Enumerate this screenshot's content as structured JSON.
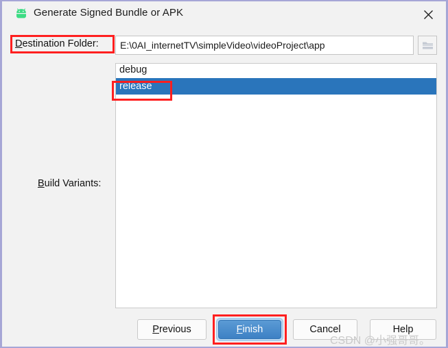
{
  "dialog": {
    "title": "Generate Signed Bundle or APK",
    "app_icon": "android-icon",
    "close_icon": "close-icon",
    "background_color": "#f2f2f2",
    "border_color": "#a6a6d6"
  },
  "destination": {
    "label_prefix": "D",
    "label_rest": "estination Folder:",
    "path_value": "E:\\0AI_internetTV\\simpleVideo\\videoProject\\app",
    "browse_icon": "folder-icon",
    "highlight_color": "#ff1f1f"
  },
  "build_variants": {
    "label_prefix": "B",
    "label_rest": "uild Variants:",
    "items": [
      {
        "label": "debug",
        "selected": false
      },
      {
        "label": "release",
        "selected": true
      }
    ],
    "selection_color": "#2a75bb",
    "highlight_color": "#ff1f1f"
  },
  "buttons": {
    "previous": {
      "prefix": "P",
      "rest": "revious"
    },
    "finish": {
      "prefix": "F",
      "rest": "inish",
      "default": true,
      "accent_color": "#4a8fd0"
    },
    "cancel": {
      "label": "Cancel"
    },
    "help": {
      "label": "Help"
    }
  },
  "watermark": {
    "text": "CSDN @小强哥哥。"
  }
}
